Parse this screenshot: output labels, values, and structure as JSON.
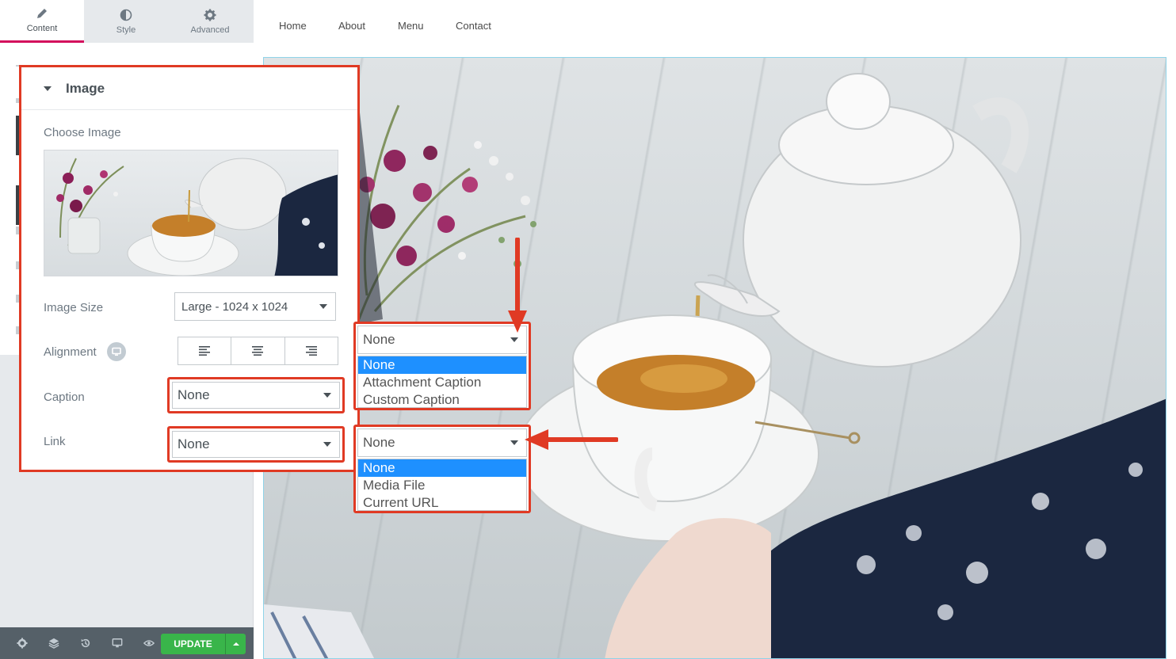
{
  "panel": {
    "tabs": [
      {
        "label": "Content",
        "icon": "pencil-icon",
        "active": true
      },
      {
        "label": "Style",
        "icon": "half-circle-icon",
        "active": false
      },
      {
        "label": "Advanced",
        "icon": "gear-icon",
        "active": false
      }
    ]
  },
  "nav": {
    "home": "Home",
    "about": "About",
    "menu": "Menu",
    "contact": "Contact"
  },
  "card": {
    "title": "Image",
    "choose_image_label": "Choose Image",
    "image_size_label": "Image Size",
    "image_size_value": "Large - 1024 x 1024",
    "alignment_label": "Alignment",
    "caption_label": "Caption",
    "caption_value": "None",
    "link_label": "Link",
    "link_value": "None"
  },
  "caption_dropdown": {
    "value": "None",
    "options": [
      "None",
      "Attachment Caption",
      "Custom Caption"
    ],
    "selected_index": 0
  },
  "link_dropdown": {
    "value": "None",
    "options": [
      "None",
      "Media File",
      "Current URL"
    ],
    "selected_index": 0
  },
  "footer": {
    "update_label": "UPDATE"
  },
  "colors": {
    "highlight": "#e03a24",
    "update_green": "#39b54a",
    "active_tab_accent": "#d30c5c",
    "selected_option": "#1e90ff"
  }
}
